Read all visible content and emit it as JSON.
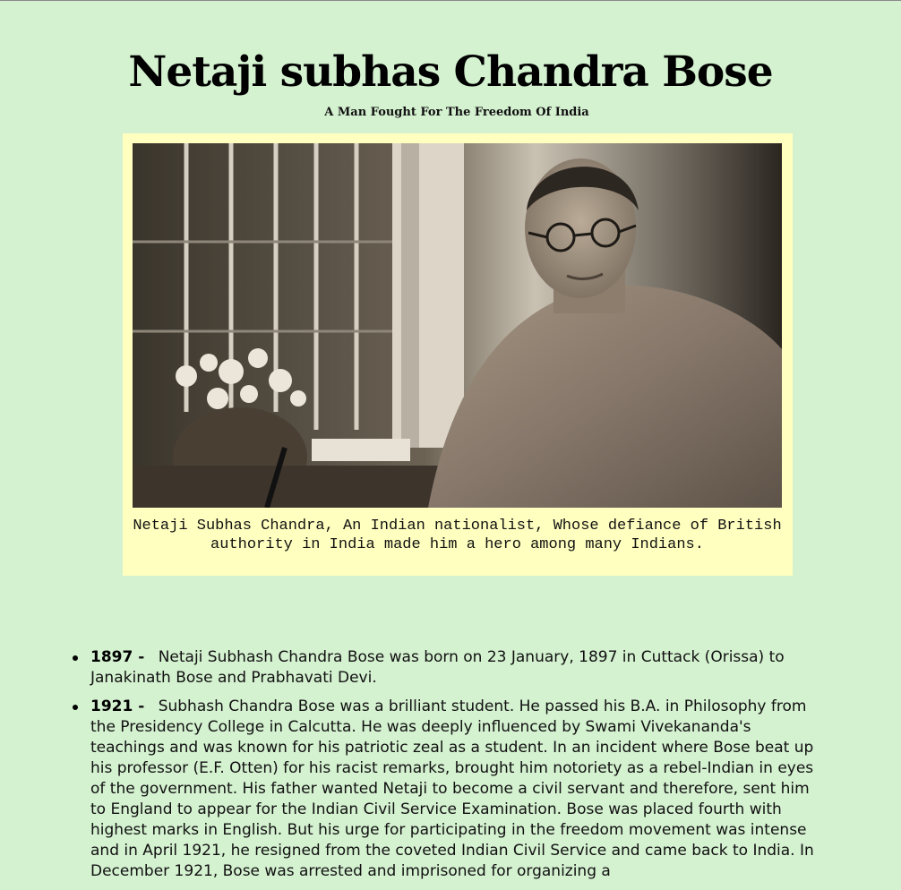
{
  "page": {
    "title": "Netaji subhas Chandra Bose",
    "subtitle": "A Man Fought For The Freedom Of India"
  },
  "figure": {
    "photo_subject": "portrait-photo",
    "caption": "Netaji Subhas Chandra, An Indian nationalist, Whose defiance of British authority in India made him a hero among many Indians."
  },
  "timeline": [
    {
      "year": "1897",
      "separator": "-",
      "text": "Netaji Subhash Chandra Bose was born on 23 January, 1897 in Cuttack (Orissa) to Janakinath Bose and Prabhavati Devi."
    },
    {
      "year": "1921",
      "separator": "-",
      "text": "Subhash Chandra Bose was a brilliant student. He passed his B.A. in Philosophy from the Presidency College in Calcutta. He was deeply influenced by Swami Vivekananda's teachings and was known for his patriotic zeal as a student. In an incident where Bose beat up his professor (E.F. Otten) for his racist remarks, brought him notoriety as a rebel-Indian in eyes of the government. His father wanted Netaji to become a civil servant and therefore, sent him to England to appear for the Indian Civil Service Examination. Bose was placed fourth with highest marks in English. But his urge for participating in the freedom movement was intense and in April 1921, he resigned from the coveted Indian Civil Service and came back to India. In December 1921, Bose was arrested and imprisoned for organizing a"
    }
  ]
}
